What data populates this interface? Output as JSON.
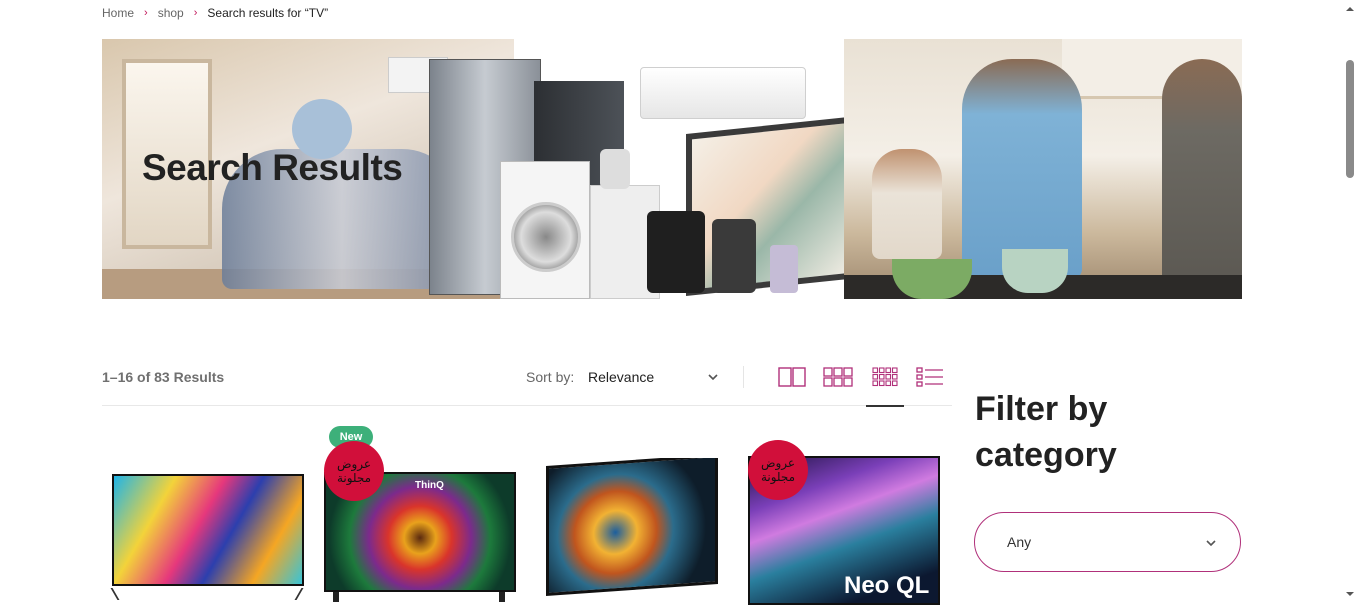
{
  "breadcrumb": {
    "items": [
      "Home",
      "shop",
      "Search results for “TV”"
    ],
    "separator": "›"
  },
  "hero": {
    "title": "Search Results"
  },
  "toolbar": {
    "results_count": "1–16 of 83 Results",
    "sort_label": "Sort by:",
    "sort_value": "Relevance",
    "views": [
      "2-column-grid",
      "3-column-grid",
      "4-column-grid",
      "list"
    ],
    "active_view": "4-column-grid",
    "accent_color": "#b0307a"
  },
  "products": [
    {
      "image": "tv-colorful-splash",
      "badges": []
    },
    {
      "image": "tv-flower-lg-qned",
      "badges": [
        "New",
        "عروض مجلونة"
      ],
      "screen_text": "ThinQ"
    },
    {
      "image": "tv-peacock",
      "badges": []
    },
    {
      "image": "tv-neo-qled",
      "badges": [
        "عروض مجلونة"
      ],
      "screen_text": "Neo QL"
    }
  ],
  "badges": {
    "new_label": "New",
    "new_color": "#3db07a",
    "offer_label": "عروض مجلونة",
    "offer_color": "#d10f3a"
  },
  "sidebar": {
    "filter_title": "Filter by category",
    "filter_value": "Any"
  }
}
